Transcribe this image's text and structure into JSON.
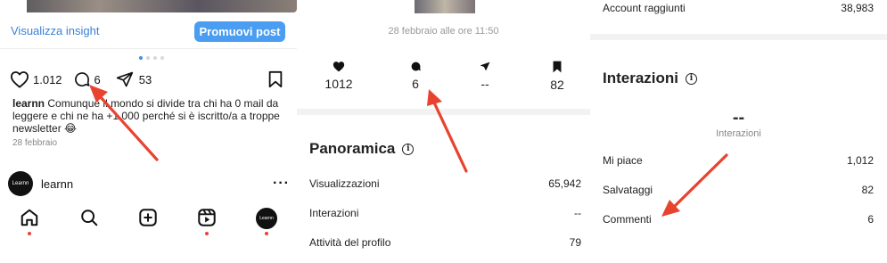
{
  "panel1": {
    "insight_link": "Visualizza insight",
    "promote_button": "Promuovi post",
    "likes_count": "1.012",
    "comments_count": "6",
    "shares_count": "53",
    "caption_user": "learnn",
    "caption_text": "Comunque il mondo si divide tra chi ha 0 mail da leggere e chi ne ha +1.000 perché si è iscritto/a a troppe newsletter 😂",
    "post_date": "28 febbraio",
    "account_name": "learnn",
    "avatar_text": "Learnn",
    "carousel_dots": 4,
    "carousel_active": 0
  },
  "panel2": {
    "post_date": "28 febbraio alle ore 11:50",
    "stats": [
      {
        "icon": "heart-icon",
        "value": "1012"
      },
      {
        "icon": "comment-icon",
        "value": "6"
      },
      {
        "icon": "share-icon",
        "value": "--"
      },
      {
        "icon": "bookmark-icon",
        "value": "82"
      }
    ],
    "section_title": "Panoramica",
    "rows": [
      {
        "label": "Visualizzazioni",
        "value": "65,942"
      },
      {
        "label": "Interazioni",
        "value": "--"
      },
      {
        "label": "Attività del profilo",
        "value": "79"
      }
    ]
  },
  "panel3": {
    "top_row": {
      "label": "Account raggiunti",
      "value": "38,983"
    },
    "section_title": "Interazioni",
    "big_value": "--",
    "big_label": "Interazioni",
    "rows": [
      {
        "label": "Mi piace",
        "value": "1,012"
      },
      {
        "label": "Salvataggi",
        "value": "82"
      },
      {
        "label": "Commenti",
        "value": "6"
      }
    ]
  },
  "colors": {
    "accent_blue": "#4a9df0",
    "link_blue": "#3b82d6",
    "annotation_red": "#e8432f"
  }
}
